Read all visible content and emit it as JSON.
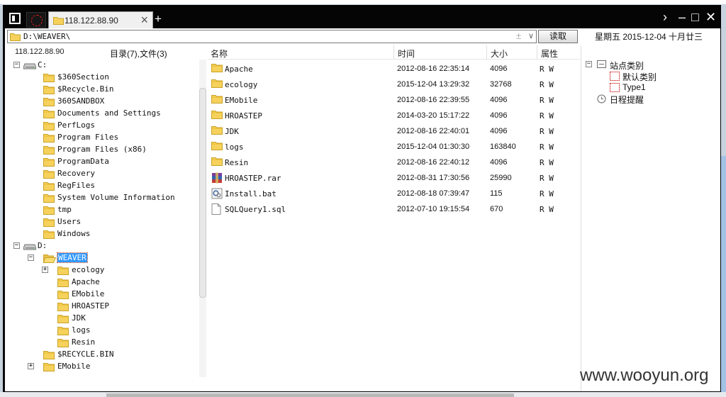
{
  "window": {
    "tab_title": "118.122.88.90",
    "tab_close": "×",
    "tab_add": "+",
    "controls": {
      "forward": "›",
      "minimize": "–",
      "maximize": "□",
      "close": "✕"
    }
  },
  "toolbar": {
    "address": "D:\\WEAVER\\",
    "address_plus": "±",
    "address_dropdown": "∨",
    "read_button": "读取",
    "date_display": "星期五 2015-12-04 十月廿三"
  },
  "left_pane": {
    "host": "118.122.88.90",
    "summary": "目录(7),文件(3)",
    "tree": [
      {
        "label": "C:",
        "level": 0,
        "type": "drive",
        "expander": "−"
      },
      {
        "label": "$360Section",
        "level": 1,
        "type": "folder"
      },
      {
        "label": "$Recycle.Bin",
        "level": 1,
        "type": "folder"
      },
      {
        "label": "360SANDBOX",
        "level": 1,
        "type": "folder"
      },
      {
        "label": "Documents and Settings",
        "level": 1,
        "type": "folder"
      },
      {
        "label": "PerfLogs",
        "level": 1,
        "type": "folder"
      },
      {
        "label": "Program Files",
        "level": 1,
        "type": "folder"
      },
      {
        "label": "Program Files (x86)",
        "level": 1,
        "type": "folder"
      },
      {
        "label": "ProgramData",
        "level": 1,
        "type": "folder"
      },
      {
        "label": "Recovery",
        "level": 1,
        "type": "folder"
      },
      {
        "label": "RegFiles",
        "level": 1,
        "type": "folder"
      },
      {
        "label": "System Volume Information",
        "level": 1,
        "type": "folder"
      },
      {
        "label": "tmp",
        "level": 1,
        "type": "folder"
      },
      {
        "label": "Users",
        "level": 1,
        "type": "folder"
      },
      {
        "label": "Windows",
        "level": 1,
        "type": "folder"
      },
      {
        "label": "D:",
        "level": 0,
        "type": "drive",
        "expander": "−"
      },
      {
        "label": "WEAVER",
        "level": 1,
        "type": "folder-open",
        "expander": "−",
        "selected": true
      },
      {
        "label": "ecology",
        "level": 2,
        "type": "folder",
        "expander": "+"
      },
      {
        "label": "Apache",
        "level": 2,
        "type": "folder"
      },
      {
        "label": "EMobile",
        "level": 2,
        "type": "folder"
      },
      {
        "label": "HROASTEP",
        "level": 2,
        "type": "folder"
      },
      {
        "label": "JDK",
        "level": 2,
        "type": "folder"
      },
      {
        "label": "logs",
        "level": 2,
        "type": "folder"
      },
      {
        "label": "Resin",
        "level": 2,
        "type": "folder"
      },
      {
        "label": "$RECYCLE.BIN",
        "level": 1,
        "type": "folder"
      },
      {
        "label": "EMobile",
        "level": 1,
        "type": "folder",
        "expander": "+"
      }
    ]
  },
  "file_list": {
    "columns": {
      "name": "名称",
      "time": "时间",
      "size": "大小",
      "attr": "属性"
    },
    "rows": [
      {
        "name": "Apache",
        "time": "2012-08-16 22:35:14",
        "size": "4096",
        "attr": "R W",
        "icon": "folder"
      },
      {
        "name": "ecology",
        "time": "2015-12-04 13:29:32",
        "size": "32768",
        "attr": "R W",
        "icon": "folder"
      },
      {
        "name": "EMobile",
        "time": "2012-08-16 22:39:55",
        "size": "4096",
        "attr": "R W",
        "icon": "folder"
      },
      {
        "name": "HROASTEP",
        "time": "2014-03-20 15:17:22",
        "size": "4096",
        "attr": "R W",
        "icon": "folder"
      },
      {
        "name": "JDK",
        "time": "2012-08-16 22:40:01",
        "size": "4096",
        "attr": "R W",
        "icon": "folder"
      },
      {
        "name": "logs",
        "time": "2015-12-04 01:30:30",
        "size": "163840",
        "attr": "R W",
        "icon": "folder"
      },
      {
        "name": "Resin",
        "time": "2012-08-16 22:40:12",
        "size": "4096",
        "attr": "R W",
        "icon": "folder"
      },
      {
        "name": "HROASTEP.rar",
        "time": "2012-08-31 17:30:56",
        "size": "25990",
        "attr": "R W",
        "icon": "rar"
      },
      {
        "name": "Install.bat",
        "time": "2012-08-18 07:39:47",
        "size": "115",
        "attr": "R W",
        "icon": "bat"
      },
      {
        "name": "SQLQuery1.sql",
        "time": "2012-07-10 19:15:54",
        "size": "670",
        "attr": "R W",
        "icon": "doc"
      }
    ]
  },
  "right_pane": {
    "tree": [
      {
        "label": "站点类别",
        "level": 0,
        "expander": "−",
        "icon": "root"
      },
      {
        "label": "默认类别",
        "level": 1,
        "icon": "category"
      },
      {
        "label": "Type1",
        "level": 1,
        "icon": "category"
      },
      {
        "label": "日程提醒",
        "level": 0,
        "icon": "reminder"
      }
    ]
  },
  "watermark": "www.wooyun.org"
}
